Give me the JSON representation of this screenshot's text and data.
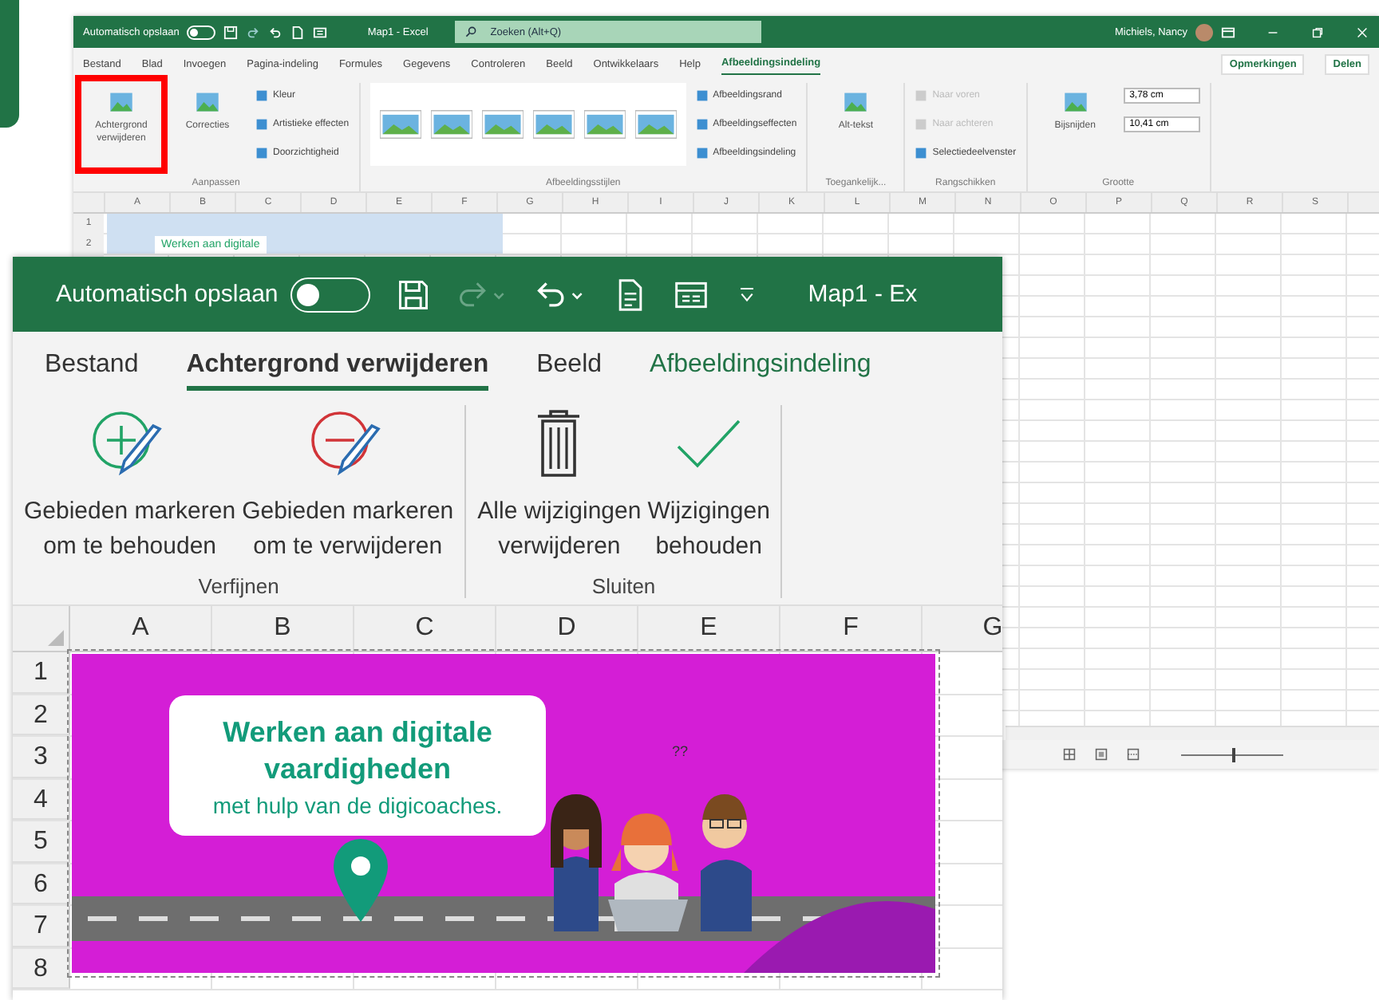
{
  "background_window": {
    "title_bar": {
      "autosave_label": "Automatisch opslaan",
      "autosave_on": false,
      "title": "Map1 - Excel",
      "search_placeholder": "Zoeken (Alt+Q)",
      "user_name": "Michiels, Nancy"
    },
    "tabs": [
      {
        "label": "Bestand",
        "selected": false
      },
      {
        "label": "Blad",
        "selected": false
      },
      {
        "label": "Invoegen",
        "selected": false
      },
      {
        "label": "Pagina-indeling",
        "selected": false
      },
      {
        "label": "Formules",
        "selected": false
      },
      {
        "label": "Gegevens",
        "selected": false
      },
      {
        "label": "Controleren",
        "selected": false
      },
      {
        "label": "Beeld",
        "selected": false
      },
      {
        "label": "Ontwikkelaars",
        "selected": false
      },
      {
        "label": "Help",
        "selected": false
      },
      {
        "label": "Afbeeldingsindeling",
        "selected": true
      }
    ],
    "tab_actions": [
      "Opmerkingen",
      "Delen"
    ],
    "ribbon_groups": [
      {
        "label": "Aanpassen",
        "items": [
          {
            "kind": "large",
            "label": "Achtergrond verwijderen",
            "highlighted": true
          },
          {
            "kind": "large",
            "label": "Correcties"
          },
          {
            "kind": "small",
            "label": "Kleur",
            "disabled": false
          },
          {
            "kind": "small",
            "label": "Artistieke effecten",
            "disabled": false
          },
          {
            "kind": "small",
            "label": "Doorzichtigheid",
            "disabled": false
          }
        ]
      },
      {
        "label": "Afbeeldingsstijlen",
        "items": [
          {
            "kind": "gallery"
          },
          {
            "kind": "small",
            "label": "Afbeeldingsrand",
            "disabled": false
          },
          {
            "kind": "small",
            "label": "Afbeeldingseffecten",
            "disabled": false
          },
          {
            "kind": "small",
            "label": "Afbeeldingsindeling",
            "disabled": false
          }
        ]
      },
      {
        "label": "Toegankelijk...",
        "items": [
          {
            "kind": "large",
            "label": "Alt-tekst"
          }
        ]
      },
      {
        "label": "Rangschikken",
        "items": [
          {
            "kind": "small",
            "label": "Naar voren",
            "disabled": true
          },
          {
            "kind": "small",
            "label": "Naar achteren",
            "disabled": true
          },
          {
            "kind": "small",
            "label": "Selectiedeelvenster",
            "disabled": false
          }
        ]
      },
      {
        "label": "Grootte",
        "items": [
          {
            "kind": "large",
            "label": "Bijsnijden"
          },
          {
            "kind": "field",
            "value": "3,78 cm"
          },
          {
            "kind": "field",
            "value": "10,41 cm"
          }
        ]
      }
    ],
    "columns": [
      "A",
      "B",
      "C",
      "D",
      "E",
      "F",
      "G",
      "H",
      "I",
      "J",
      "K",
      "L",
      "M",
      "N",
      "O",
      "P",
      "Q",
      "R",
      "S"
    ],
    "rows": [
      "1",
      "2"
    ],
    "picture_text": "Werken aan digitale",
    "status_bar": {
      "zoom_slider": {
        "level": 0.5
      }
    }
  },
  "front_window": {
    "title_bar": {
      "autosave_label": "Automatisch opslaan",
      "autosave_on": false,
      "title": "Map1 - Ex"
    },
    "tabs": [
      {
        "label": "Bestand",
        "selected": false,
        "kind": "normal"
      },
      {
        "label": "Achtergrond verwijderen",
        "selected": true,
        "kind": "normal"
      },
      {
        "label": "Beeld",
        "selected": false,
        "kind": "normal"
      },
      {
        "label": "Afbeeldingsindeling",
        "selected": false,
        "kind": "contextual"
      }
    ],
    "ribbon_groups": [
      {
        "label": "Verfijnen",
        "buttons": [
          {
            "kind": "mark-keep",
            "lines": [
              "Gebieden markeren",
              "om te behouden"
            ]
          },
          {
            "kind": "mark-remove",
            "lines": [
              "Gebieden markeren",
              "om te verwijderen"
            ]
          }
        ]
      },
      {
        "label": "Sluiten",
        "buttons": [
          {
            "kind": "discard",
            "lines": [
              "Alle wijzigingen",
              "verwijderen"
            ]
          },
          {
            "kind": "keep",
            "lines": [
              "Wijzigingen",
              "behouden"
            ]
          }
        ]
      }
    ],
    "columns": [
      "A",
      "B",
      "C",
      "D",
      "E",
      "F",
      "G"
    ],
    "rows": [
      "1",
      "2",
      "3",
      "4",
      "5",
      "6",
      "7",
      "8"
    ],
    "banner": {
      "title": "Werken aan digitale vaardigheden",
      "subtitle": "met hulp van de digicoaches.",
      "marks": "??"
    }
  }
}
